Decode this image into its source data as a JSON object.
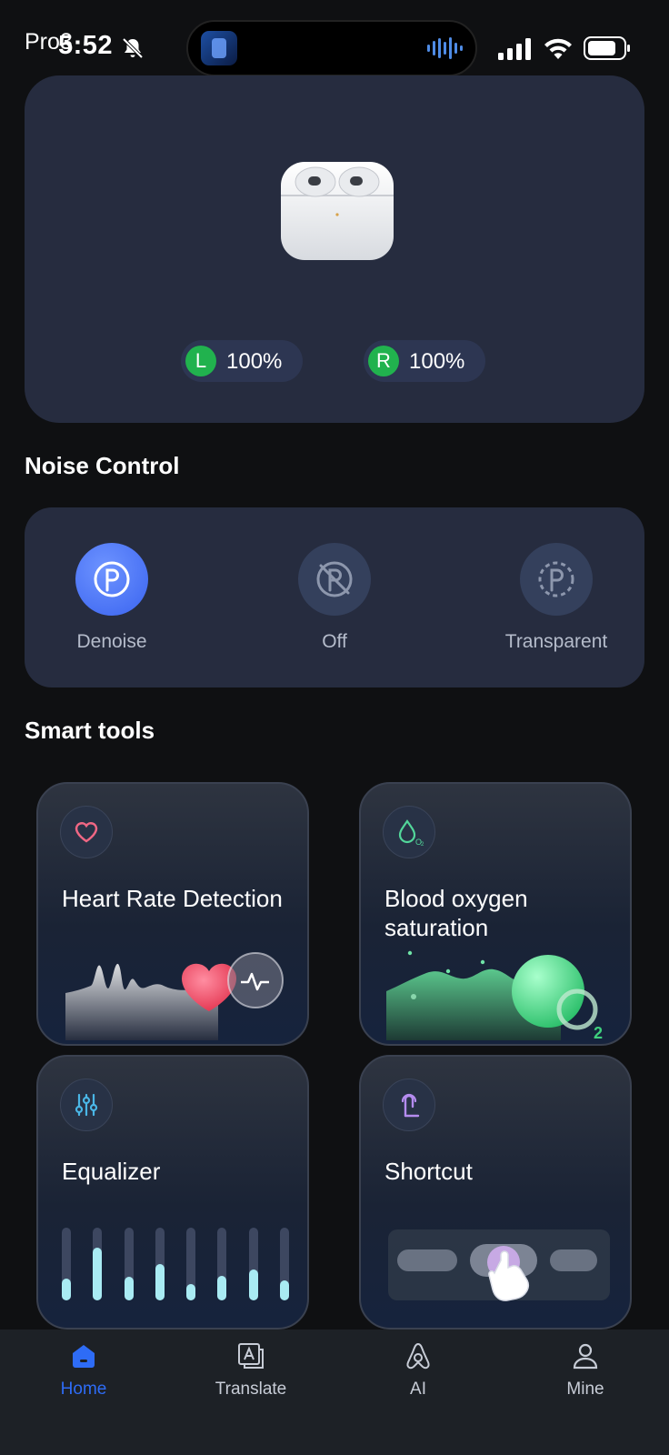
{
  "status_bar": {
    "app_label": "Pro3",
    "time": "5:52"
  },
  "earbuds": {
    "left": {
      "badge": "L",
      "battery": "100%"
    },
    "right": {
      "badge": "R",
      "battery": "100%"
    }
  },
  "noise_control": {
    "title": "Noise Control",
    "options": [
      {
        "label": "Denoise",
        "active": true
      },
      {
        "label": "Off",
        "active": false
      },
      {
        "label": "Transparent",
        "active": false
      }
    ]
  },
  "smart_tools": {
    "title": "Smart tools",
    "cards": [
      {
        "title": "Heart Rate Detection",
        "icon": "heart-icon"
      },
      {
        "title": "Blood oxygen saturation",
        "icon": "o2-drop-icon",
        "corner_label": "2"
      },
      {
        "title": "Equalizer",
        "icon": "sliders-icon"
      },
      {
        "title": "Shortcut",
        "icon": "touch-icon"
      }
    ]
  },
  "equalizer_levels": [
    0.3,
    0.72,
    0.32,
    0.5,
    0.22,
    0.34,
    0.42,
    0.27
  ],
  "bottom_nav": {
    "items": [
      {
        "label": "Home",
        "icon": "home-icon",
        "active": true
      },
      {
        "label": "Translate",
        "icon": "translate-icon",
        "active": false
      },
      {
        "label": "AI",
        "icon": "ai-icon",
        "active": false
      },
      {
        "label": "Mine",
        "icon": "user-icon",
        "active": false
      }
    ]
  },
  "colors": {
    "accent": "#2e6cf6",
    "battery_badge": "#21b24e",
    "card_bg": "#262c3f"
  }
}
